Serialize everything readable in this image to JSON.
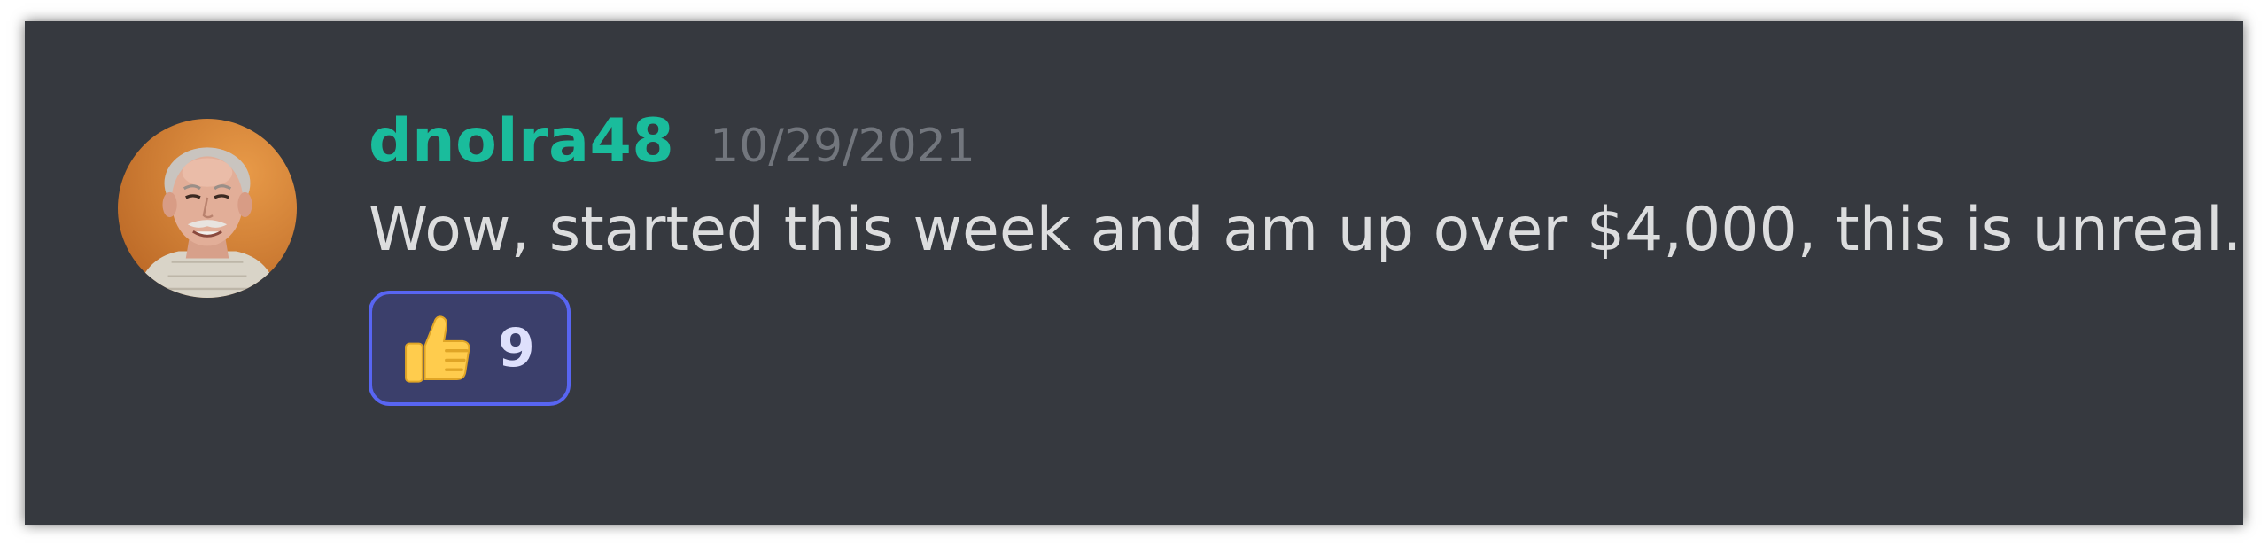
{
  "message": {
    "author": {
      "username": "dnolra48",
      "name_color": "#1abc9c",
      "avatar": "user-avatar-photo"
    },
    "timestamp": "10/29/2021",
    "content": "Wow, started this week and am up over $4,000, this is unreal.",
    "reactions": [
      {
        "emoji": "thumbs-up-icon",
        "count": "9",
        "active": true,
        "border_color": "#5865f2"
      }
    ]
  },
  "theme": {
    "background": "#36393f",
    "text": "#dcddde",
    "muted": "#72767d"
  }
}
